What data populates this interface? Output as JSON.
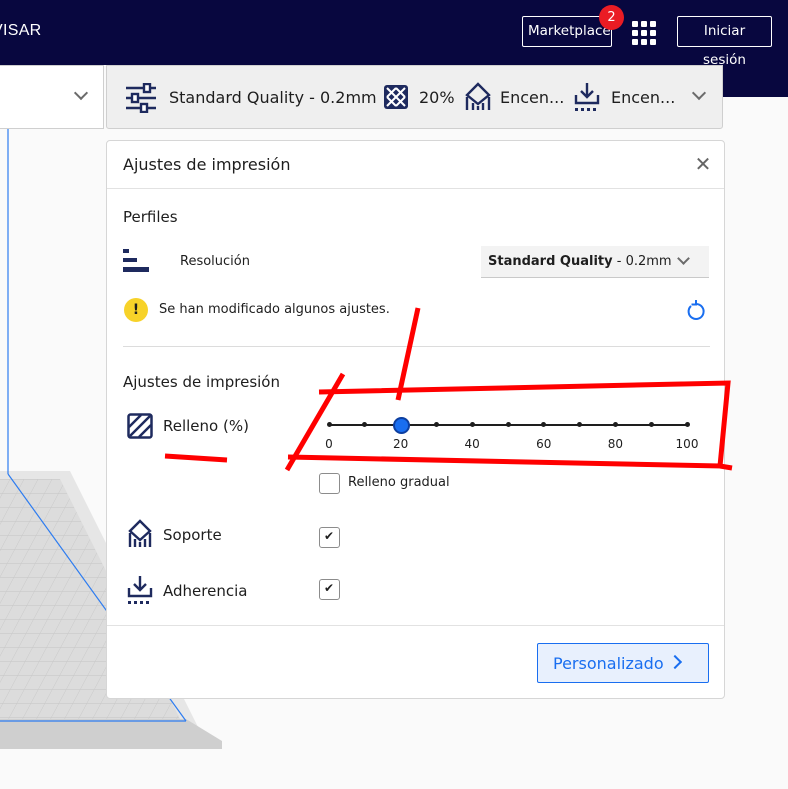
{
  "header": {
    "section_label": "VISAR",
    "marketplace_label": "Marketplace",
    "marketplace_badge": "2",
    "apps_icon": "apps-grid-icon",
    "login_label": "Iniciar sesión"
  },
  "print_setup_bar": {
    "profile_text": "Standard Quality - 0.2mm",
    "infill_text": "20%",
    "support_text": "Encen...",
    "adhesion_text": "Encen...",
    "icons": [
      "sliders-icon",
      "infill-pattern-icon",
      "support-icon",
      "adhesion-icon",
      "chevron-down-icon"
    ]
  },
  "panel": {
    "title": "Ajustes de impresión",
    "close_icon": "close-icon",
    "profiles_heading": "Perfiles",
    "resolution_label": "Resolución",
    "resolution_value_bold": "Standard Quality",
    "resolution_value_rest": " - 0.2mm",
    "warning_text": "Se han modificado algunos ajustes.",
    "reset_icon": "reset-icon",
    "settings_heading": "Ajustes de impresión",
    "infill_label": "Relleno (%)",
    "infill_value": 20,
    "infill_ticks": [
      "0",
      "20",
      "40",
      "60",
      "80",
      "100"
    ],
    "gradual_label": "Relleno gradual",
    "gradual_checked": false,
    "support_label": "Soporte",
    "support_checked": true,
    "adhesion_label": "Adherencia",
    "adhesion_checked": true,
    "custom_button_label": "Personalizado"
  },
  "colors": {
    "header_bg": "#08073f",
    "accent": "#196ef0",
    "badge": "#ea1c24",
    "warning": "#f7d229",
    "annotation": "#ff0000",
    "plate_outline": "#2d7cf0"
  }
}
